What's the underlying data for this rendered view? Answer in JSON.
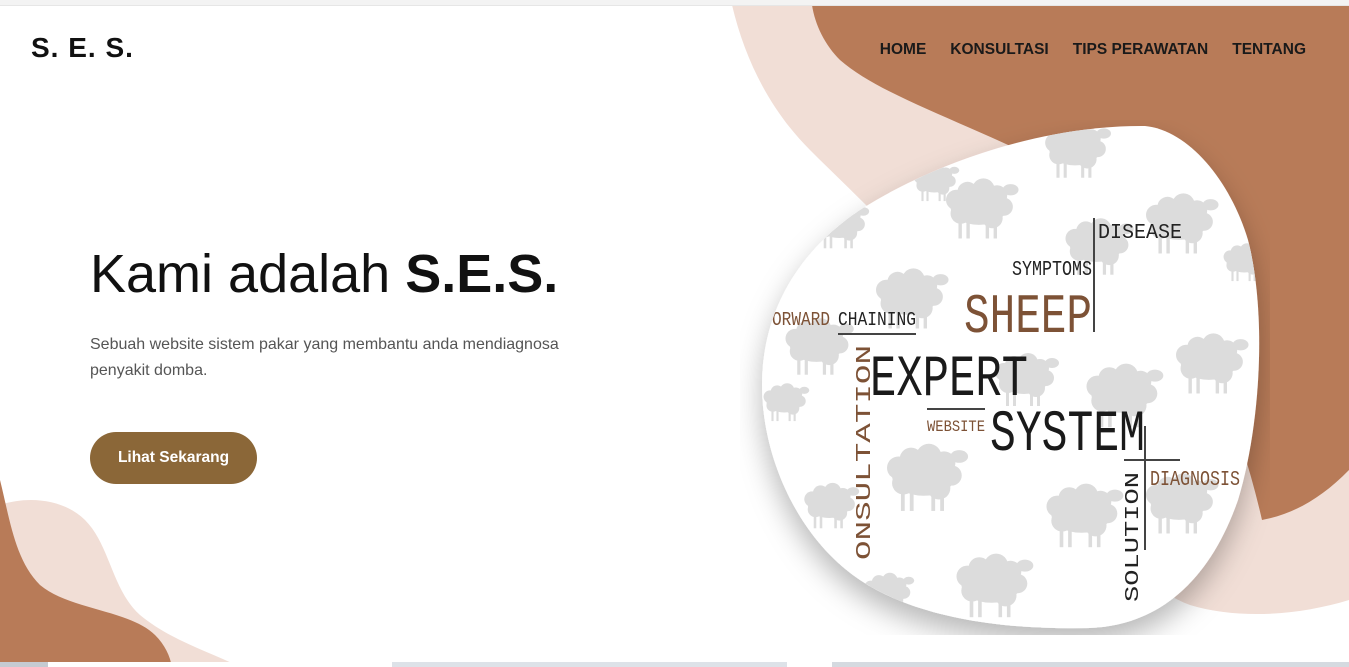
{
  "brand": {
    "logo": "S. E. S."
  },
  "nav": {
    "items": [
      {
        "label": "HOME"
      },
      {
        "label": "KONSULTASI"
      },
      {
        "label": "TIPS PERAWATAN"
      },
      {
        "label": "TENTANG"
      }
    ]
  },
  "hero": {
    "title_prefix": "Kami adalah ",
    "title_strong": "S.E.S.",
    "description": "Sebuah website sistem pakar yang membantu anda mendiagnosa penyakit domba.",
    "cta_label": "Lihat Sekarang"
  },
  "illustration": {
    "icon": "sheep-icon",
    "words": {
      "disease": "DISEASE",
      "symptoms": "SYMPTOMS",
      "sheep": "SHEEP",
      "forward_chaining_a": "ORWARD",
      "forward_chaining_b": "CHAINING",
      "expert": "EXPERT",
      "consultation": "ONSULTATION",
      "website": "WEBSITE",
      "system": "SYSTEM",
      "diagnosis": "DIAGNOSIS",
      "solution": "SOLUTION"
    }
  },
  "colors": {
    "accent": "#b87b58",
    "accent_light": "#f1ded6",
    "button": "#8b6738",
    "sheep": "#dcdcdc"
  }
}
